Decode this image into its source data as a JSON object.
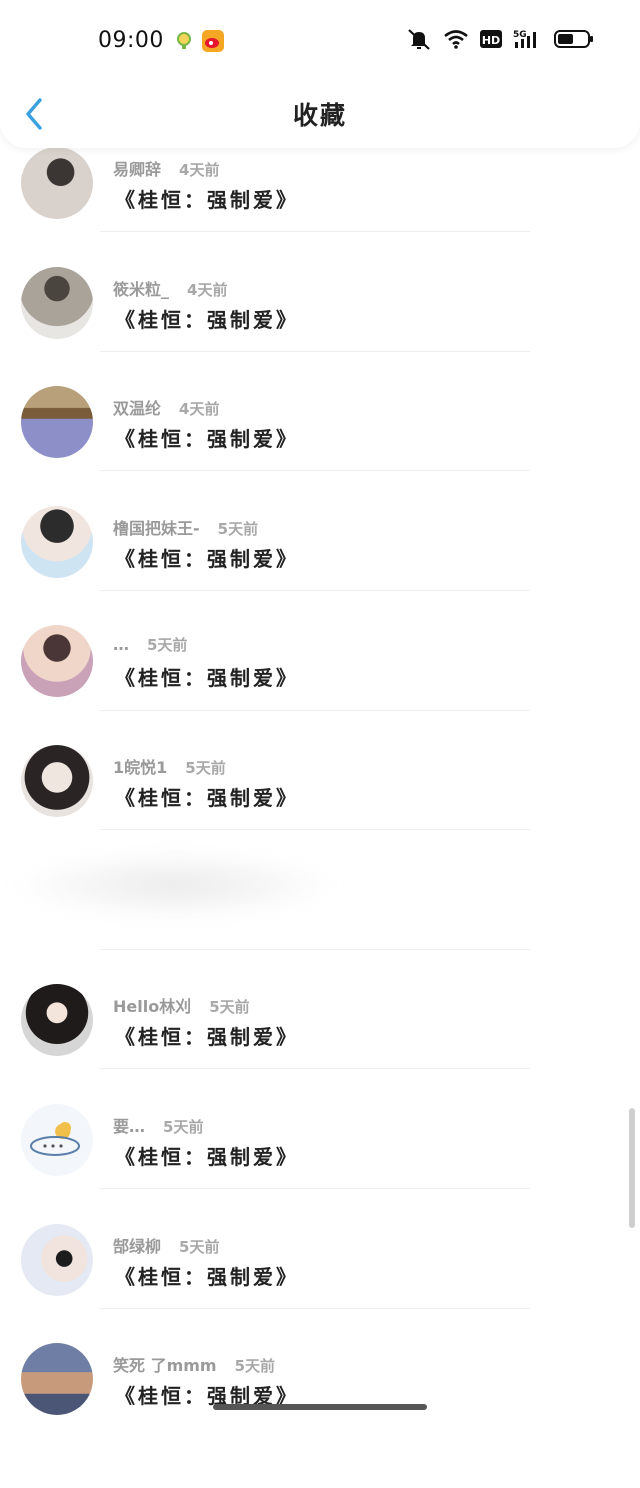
{
  "status_bar": {
    "time": "09:00",
    "icons": [
      "notification-app-icon",
      "weibo-icon",
      "silent-bell-icon",
      "wifi-icon",
      "hd-icon",
      "5g-signal-icon",
      "battery-icon"
    ],
    "hd_label": "HD",
    "network_label": "5G"
  },
  "nav": {
    "title": "收藏",
    "back_icon": "back-arrow-icon",
    "accent": "#3aa0e0"
  },
  "items": [
    {
      "user": "易卿辞",
      "time_ago": "4天前",
      "title": "《桂恒：强制爱》",
      "avatar_colors": [
        "#d9d2cc",
        "#3b3533"
      ]
    },
    {
      "user": "筱米粒_",
      "time_ago": "4天前",
      "title": "《桂恒：强制爱》",
      "avatar_colors": [
        "#a9a39a",
        "#4b4540"
      ]
    },
    {
      "user": "双温纶",
      "time_ago": "4天前",
      "title": "《桂恒：强制爱》",
      "avatar_colors": [
        "#8c8fc8",
        "#6b5a3e"
      ]
    },
    {
      "user": "橹国把妹王-",
      "time_ago": "5天前",
      "title": "《桂恒：强制爱》",
      "avatar_colors": [
        "#cfe4f3",
        "#2c2c2c"
      ]
    },
    {
      "user": "…",
      "time_ago": "5天前",
      "title": "《桂恒：强制爱》",
      "avatar_colors": [
        "#c9a2b8",
        "#4a3636"
      ]
    },
    {
      "user": "1皖悦1",
      "time_ago": "5天前",
      "title": "《桂恒：强制爱》",
      "avatar_colors": [
        "#e9e3df",
        "#2a2424"
      ]
    },
    {
      "user": "Hello林刈",
      "time_ago": "5天前",
      "title": "《桂恒：强制爱》",
      "avatar_colors": [
        "#d6d6d6",
        "#1f1b1b"
      ]
    },
    {
      "user": "要…",
      "time_ago": "5天前",
      "title": "《桂恒：强制爱》",
      "avatar_colors": [
        "#f3f7fb",
        "#f1c04a"
      ]
    },
    {
      "user": "郜绿柳",
      "time_ago": "5天前",
      "title": "《桂恒：强制爱》",
      "avatar_colors": [
        "#e5e9f3",
        "#1c1c1c"
      ]
    },
    {
      "user": "笑死 了mmm",
      "time_ago": "5天前",
      "title": "《桂恒：强制爱》",
      "avatar_colors": [
        "#6f7ea4",
        "#c79a7c"
      ]
    }
  ]
}
